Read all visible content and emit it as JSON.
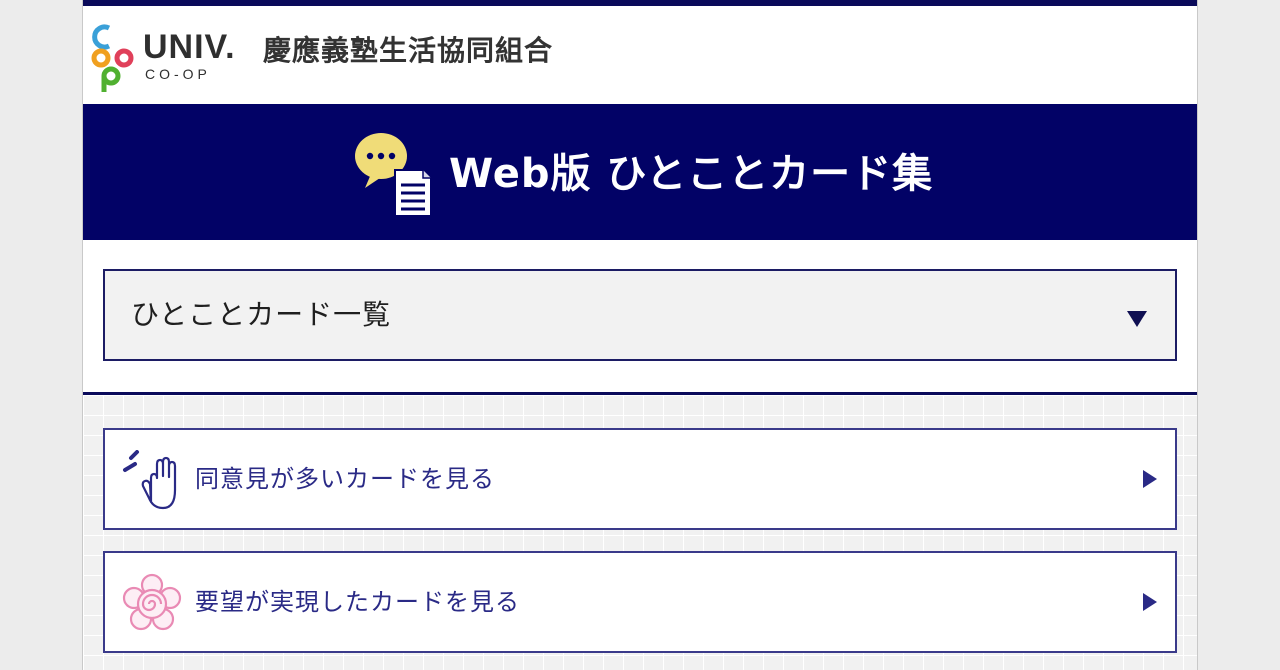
{
  "header": {
    "logo_univ": "UNIV.",
    "logo_coop": "CO-OP",
    "org_name": "慶應義塾生活協同組合"
  },
  "banner": {
    "icon": "speech-bubble-document-icon",
    "title": "Web版 ひとことカード集"
  },
  "category_select": {
    "selected": "ひとことカード一覧",
    "icon": "triangle-down-icon"
  },
  "links": [
    {
      "label": "同意見が多いカードを見る",
      "icon": "raised-hand-icon"
    },
    {
      "label": "要望が実現したカードを見る",
      "icon": "flower-icon"
    }
  ],
  "colors": {
    "navy": "#020266",
    "link_text": "#2a2a86",
    "bubble_yellow": "#f0dc78",
    "flower_pink": "#e98ab4"
  }
}
